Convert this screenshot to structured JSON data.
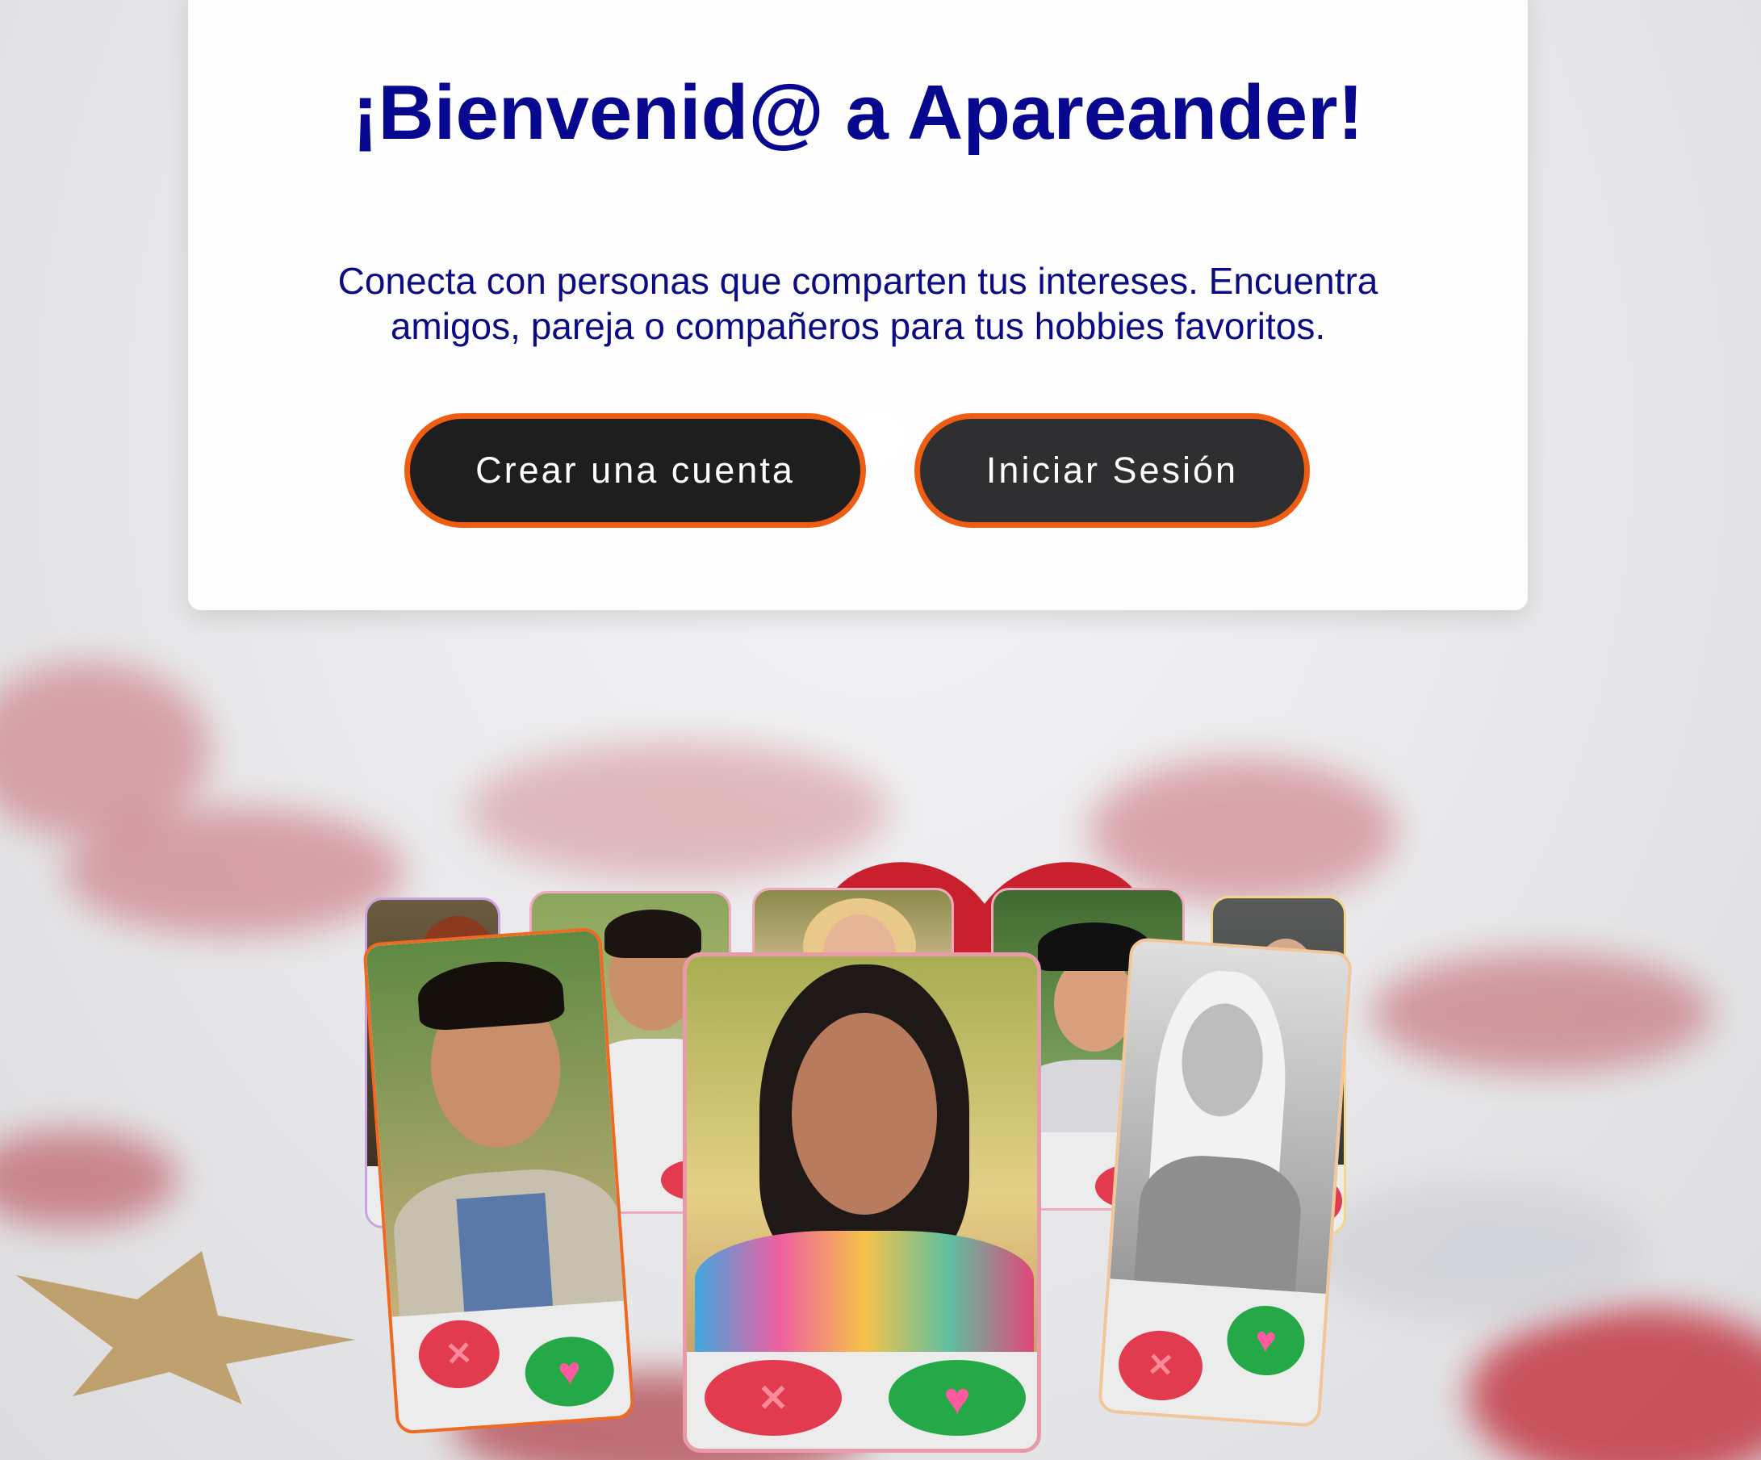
{
  "hero": {
    "title": "¡Bienvenid@ a Apareander!",
    "subtitle": "Conecta con personas que comparten tus intereses. Encuentra amigos, pareja o compañeros para tus hobbies favoritos."
  },
  "buttons": {
    "create_account": "Crear una cuenta",
    "login": "Iniciar Sesión"
  },
  "illustration": {
    "reject_symbol": "✕",
    "like_symbol": "♥"
  },
  "colors": {
    "title": "#07078f",
    "button_border": "#ee5d12",
    "button_bg": "#1e1e1f",
    "reject": "#e23a4e",
    "like": "#25a848"
  }
}
